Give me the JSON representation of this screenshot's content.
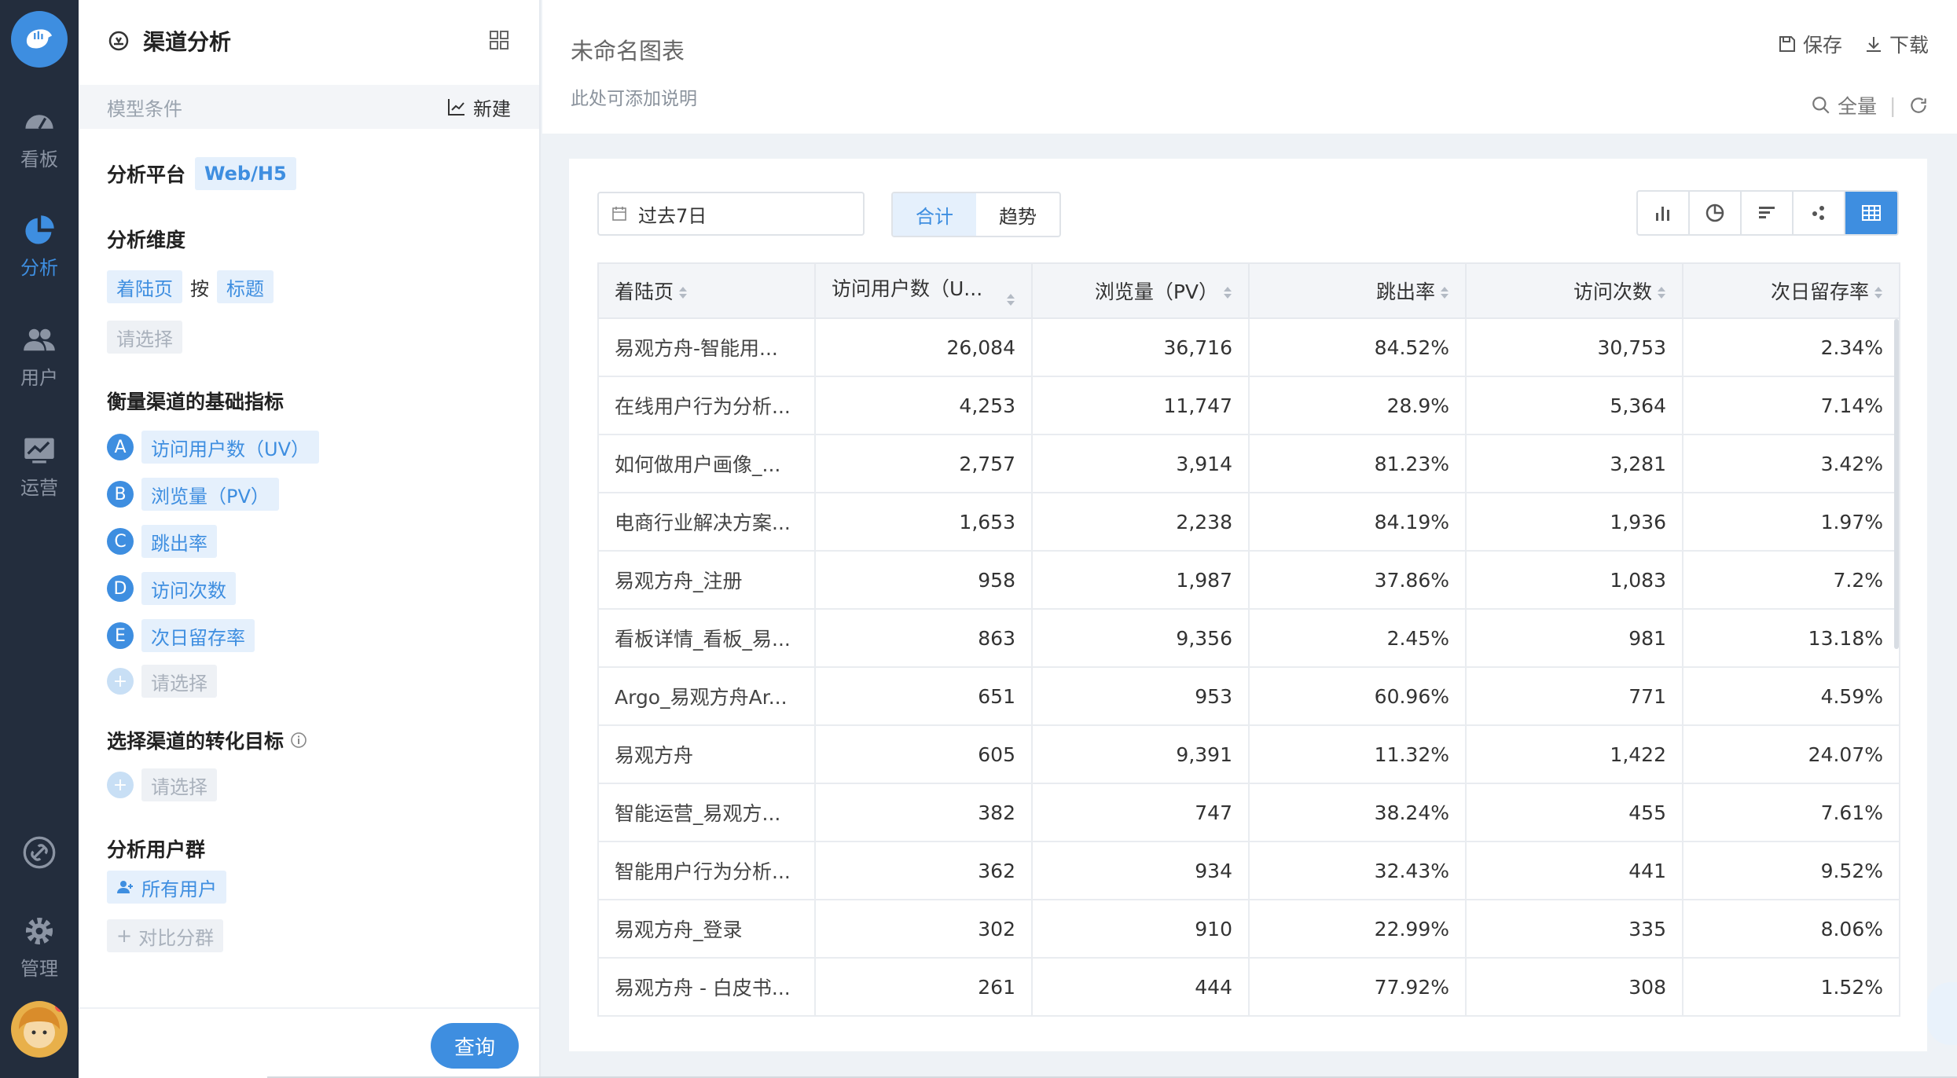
{
  "nav": {
    "items": [
      {
        "label": "看板",
        "icon": "dashboard-icon"
      },
      {
        "label": "分析",
        "icon": "pie-chart-icon"
      },
      {
        "label": "用户",
        "icon": "users-icon"
      },
      {
        "label": "运营",
        "icon": "operations-icon"
      }
    ],
    "bottom": [
      {
        "label": "",
        "icon": "link-icon"
      },
      {
        "label": "管理",
        "icon": "gear-icon"
      }
    ],
    "accent": "#3e8ee0"
  },
  "panel": {
    "title": "渠道分析",
    "model_label": "模型条件",
    "new_label": "新建",
    "platform": {
      "title": "分析平台",
      "value": "Web/H5"
    },
    "dimension": {
      "title": "分析维度",
      "primary": "着陆页",
      "by": "按",
      "secondary": "标题",
      "placeholder": "请选择"
    },
    "metrics": {
      "title": "衡量渠道的基础指标",
      "items": [
        {
          "letter": "A",
          "label": "访问用户数（UV）"
        },
        {
          "letter": "B",
          "label": "浏览量（PV）"
        },
        {
          "letter": "C",
          "label": "跳出率"
        },
        {
          "letter": "D",
          "label": "访问次数"
        },
        {
          "letter": "E",
          "label": "次日留存率"
        }
      ],
      "add_placeholder": "请选择"
    },
    "goal": {
      "title": "选择渠道的转化目标",
      "placeholder": "请选择"
    },
    "usergroup": {
      "title": "分析用户群",
      "value": "所有用户",
      "compare": "对比分群"
    },
    "query": "查询"
  },
  "header": {
    "title": "未命名图表",
    "description": "此处可添加说明",
    "save": "保存",
    "download": "下载",
    "full": "全量"
  },
  "toolbar": {
    "date": "过去7日",
    "seg_total": "合计",
    "seg_trend": "趋势"
  },
  "table": {
    "columns": [
      "着陆页",
      "访问用户数（U...",
      "浏览量（PV）",
      "跳出率",
      "访问次数",
      "次日留存率"
    ],
    "rows": [
      [
        "易观方舟-智能用...",
        "26,084",
        "36,716",
        "84.52%",
        "30,753",
        "2.34%"
      ],
      [
        "在线用户行为分析...",
        "4,253",
        "11,747",
        "28.9%",
        "5,364",
        "7.14%"
      ],
      [
        "如何做用户画像_...",
        "2,757",
        "3,914",
        "81.23%",
        "3,281",
        "3.42%"
      ],
      [
        "电商行业解决方案...",
        "1,653",
        "2,238",
        "84.19%",
        "1,936",
        "1.97%"
      ],
      [
        "易观方舟_注册",
        "958",
        "1,987",
        "37.86%",
        "1,083",
        "7.2%"
      ],
      [
        "看板详情_看板_易...",
        "863",
        "9,356",
        "2.45%",
        "981",
        "13.18%"
      ],
      [
        "Argo_易观方舟Ar...",
        "651",
        "953",
        "60.96%",
        "771",
        "4.59%"
      ],
      [
        "易观方舟",
        "605",
        "9,391",
        "11.32%",
        "1,422",
        "24.07%"
      ],
      [
        "智能运营_易观方...",
        "382",
        "747",
        "38.24%",
        "455",
        "7.61%"
      ],
      [
        "智能用户行为分析...",
        "362",
        "934",
        "32.43%",
        "441",
        "9.52%"
      ],
      [
        "易观方舟_登录",
        "302",
        "910",
        "22.99%",
        "335",
        "8.06%"
      ],
      [
        "易观方舟 - 白皮书...",
        "261",
        "444",
        "77.92%",
        "308",
        "1.52%"
      ]
    ]
  }
}
